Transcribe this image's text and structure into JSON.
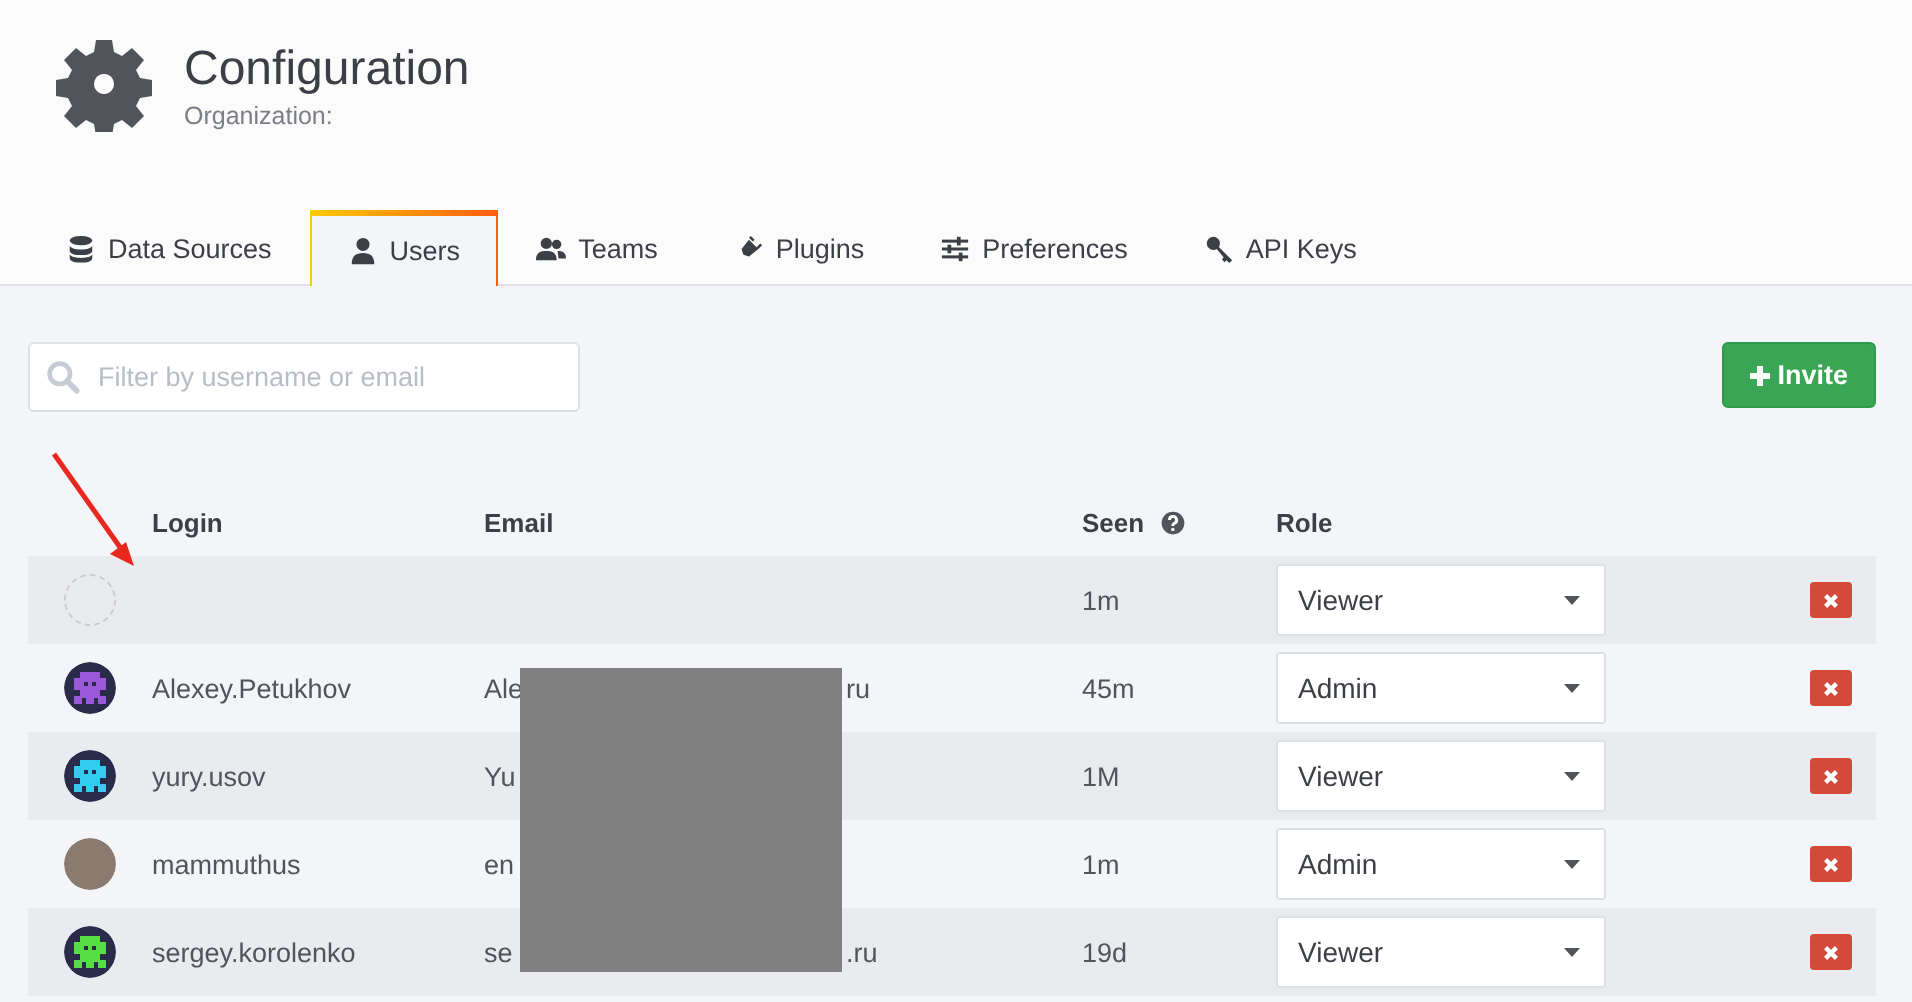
{
  "header": {
    "title": "Configuration",
    "subtitle": "Organization:"
  },
  "tabs": [
    {
      "label": "Data Sources",
      "selected": false
    },
    {
      "label": "Users",
      "selected": true
    },
    {
      "label": "Teams",
      "selected": false
    },
    {
      "label": "Plugins",
      "selected": false
    },
    {
      "label": "Preferences",
      "selected": false
    },
    {
      "label": "API Keys",
      "selected": false
    }
  ],
  "search": {
    "placeholder": "Filter by username or email"
  },
  "invite_button": {
    "label": "Invite"
  },
  "table": {
    "columns": [
      "Login",
      "Email",
      "Seen",
      "Role"
    ],
    "rows": [
      {
        "login": "",
        "email_start": "",
        "email_end": "",
        "seen": "1m",
        "role": "Viewer"
      },
      {
        "login": "Alexey.Petukhov",
        "email_start": "Ale",
        "email_end": "ru",
        "seen": "45m",
        "role": "Admin"
      },
      {
        "login": "yury.usov",
        "email_start": "Yu",
        "email_end": "",
        "seen": "1M",
        "role": "Viewer"
      },
      {
        "login": "mammuthus",
        "email_start": "en",
        "email_end": "",
        "seen": "1m",
        "role": "Admin"
      },
      {
        "login": "sergey.korolenko",
        "email_start": "se",
        "email_end": ".ru",
        "seen": "19d",
        "role": "Viewer"
      }
    ]
  }
}
